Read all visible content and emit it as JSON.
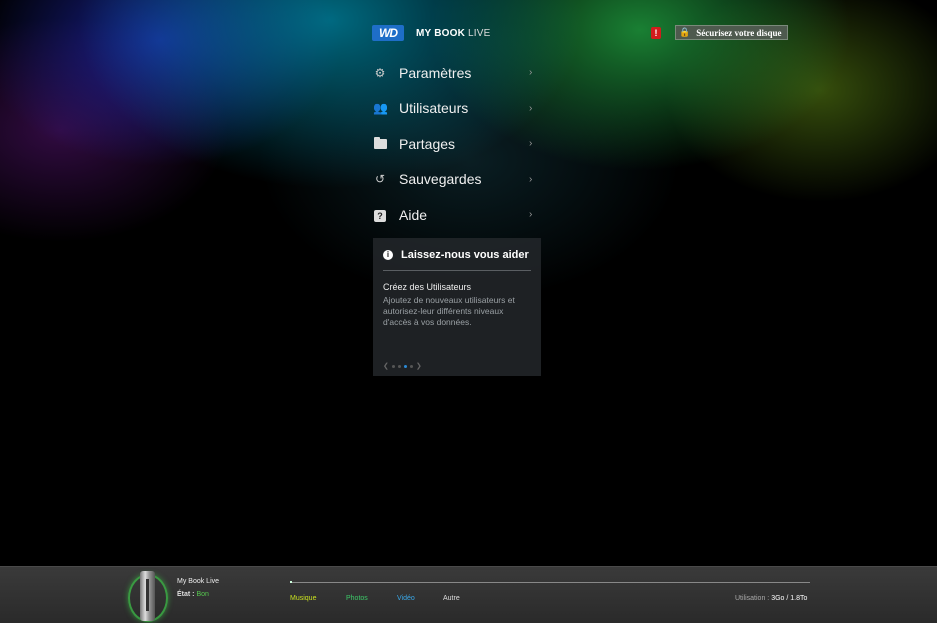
{
  "header": {
    "logo_text": "WD",
    "brand_main": "MY BOOK",
    "brand_sub": "LIVE",
    "alert_symbol": "!",
    "secure_label": "Sécurisez votre disque"
  },
  "menu": {
    "items": [
      {
        "label": "Paramètres",
        "icon": "gear-icon"
      },
      {
        "label": "Utilisateurs",
        "icon": "users-icon"
      },
      {
        "label": "Partages",
        "icon": "folder-icon"
      },
      {
        "label": "Sauvegardes",
        "icon": "history-icon"
      },
      {
        "label": "Aide",
        "icon": "help-icon"
      }
    ],
    "chevron": "›"
  },
  "help_panel": {
    "title": "Laissez-nous vous aider",
    "subtitle": "Créez des Utilisateurs",
    "text": "Ajoutez de nouveaux utilisateurs et autorisez-leur différents niveaux d'accès à vos données.",
    "pager": {
      "count": 4,
      "active_index": 2
    }
  },
  "footer": {
    "device_name": "My Book Live",
    "state_label": "État :",
    "state_value": "Bon",
    "categories": {
      "music": "Musique",
      "photos": "Photos",
      "video": "Vidéo",
      "other": "Autre"
    },
    "usage_label": "Utilisation :",
    "usage_value": "3Go / 1.8To",
    "usage_fraction": 0.002
  },
  "colors": {
    "wd_blue": "#1e6ec8",
    "alert_red": "#d21c1c",
    "state_good": "#55c84e",
    "music": "#c8e020",
    "photos": "#3cc868",
    "video": "#3aa8e8",
    "pager_active": "#2a8ad6"
  }
}
